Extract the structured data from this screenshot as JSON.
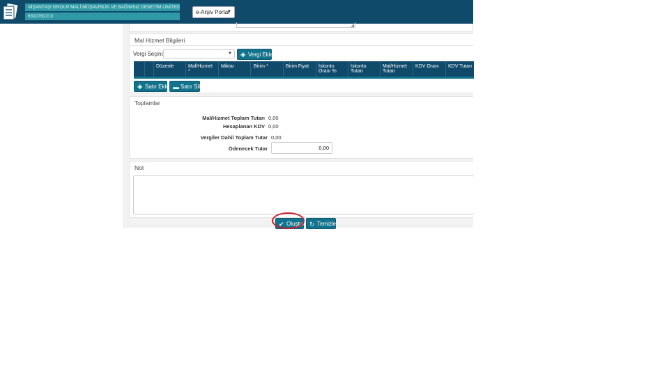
{
  "header": {
    "company_name": "NİŞANTAŞI GROUP MALİ MÜŞAVİRLİK VE BAĞIMSIZ DENETİM LİMİTED ŞİRKETİ",
    "tax_id": "6310762213",
    "portal_select_value": "e-Arşiv Portal"
  },
  "mal_hizmet": {
    "title": "Mal Hizmet Bilgileri",
    "vergi_label": "Vergi Seçiniz:",
    "vergi_select_value": "",
    "vergi_ekle_label": "Vergi Ekle",
    "columns": [
      {
        "l1": "Düzenle",
        "l2": ""
      },
      {
        "l1": "Mal/Hizmet",
        "l2": "*"
      },
      {
        "l1": "Miktar",
        "l2": ""
      },
      {
        "l1": "Birim *",
        "l2": ""
      },
      {
        "l1": "Birim Fiyat",
        "l2": ""
      },
      {
        "l1": "İskonto",
        "l2": "Oranı %"
      },
      {
        "l1": "İskonto",
        "l2": "Tutarı"
      },
      {
        "l1": "Mal/Hizmet",
        "l2": "Tutarı"
      },
      {
        "l1": "KDV Oranı",
        "l2": ""
      },
      {
        "l1": "KDV Tutarı",
        "l2": ""
      }
    ],
    "satir_ekle_label": "Satır Ekle",
    "satir_sil_label": "Satır Sil"
  },
  "toplamlar": {
    "title": "Toplamlar",
    "mal_hizmet_toplam_label": "Mal/Hizmet Toplam Tutarı",
    "mal_hizmet_toplam_value": "0,00",
    "hesaplanan_kdv_label": "Hesaplanan KDV",
    "hesaplanan_kdv_value": "0,00",
    "vergiler_dahil_label": "Vergiler Dahil Toplam Tutar",
    "vergiler_dahil_value": "0,00",
    "odenecek_label": "Ödenecek Tutar",
    "odenecek_value": "0,00"
  },
  "not": {
    "title": "Not",
    "value": ""
  },
  "actions": {
    "olustur_label": "Oluştur",
    "temizle_label": "Temizle"
  },
  "colors": {
    "header_bg": "#0f4a6b",
    "badge_bg": "#2f9aa6",
    "button_bg": "#13728c",
    "highlight": "#cc1f2a"
  }
}
